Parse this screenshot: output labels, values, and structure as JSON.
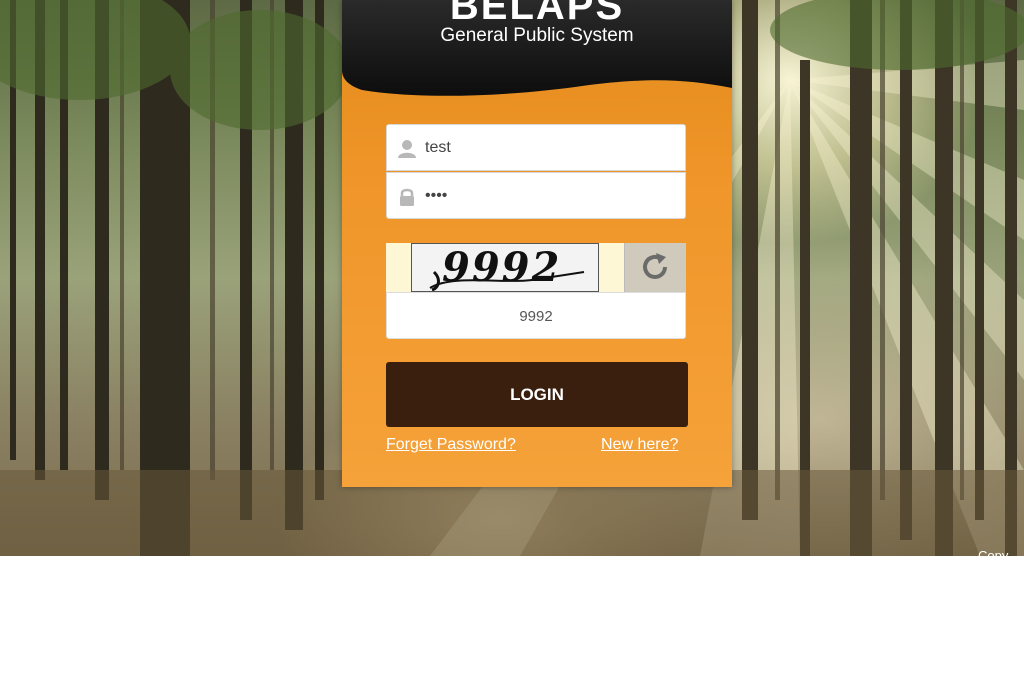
{
  "brand": {
    "title": "BELAPS",
    "subtitle": "General Public System"
  },
  "login_form": {
    "username_value": "test",
    "password_value": "••••",
    "captcha_image_text": "9992",
    "captcha_input_value": "9992",
    "login_label": "LOGIN",
    "forget_password_label": "Forget Password?",
    "new_here_label": "New here?"
  },
  "footer": {
    "copyright_fragment": "Copy"
  },
  "icons": {
    "username": "user-icon",
    "password": "lock-icon",
    "refresh": "refresh-icon"
  },
  "colors": {
    "panel_orange": "#f0962a",
    "panel_header_dark": "#1f1f1f",
    "login_button": "#3a1f0e",
    "captcha_row": "#fdf7d6"
  }
}
